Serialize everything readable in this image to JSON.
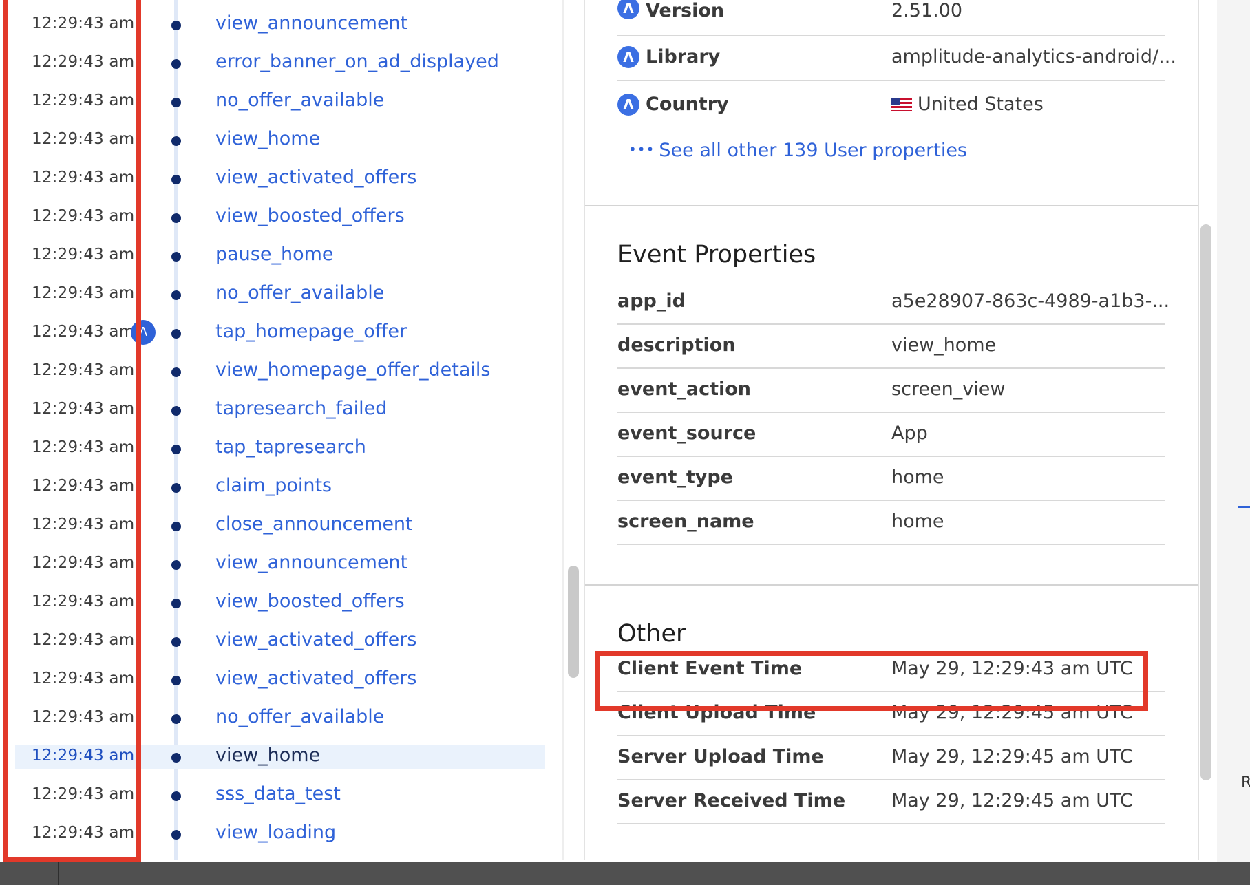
{
  "timeline": {
    "rows": [
      {
        "time": "12:29:43 am",
        "event": "view_announcement"
      },
      {
        "time": "12:29:43 am",
        "event": "error_banner_on_ad_displayed"
      },
      {
        "time": "12:29:43 am",
        "event": "no_offer_available"
      },
      {
        "time": "12:29:43 am",
        "event": "view_home"
      },
      {
        "time": "12:29:43 am",
        "event": "view_activated_offers"
      },
      {
        "time": "12:29:43 am",
        "event": "view_boosted_offers"
      },
      {
        "time": "12:29:43 am",
        "event": "pause_home"
      },
      {
        "time": "12:29:43 am",
        "event": "no_offer_available"
      },
      {
        "time": "12:29:43 am",
        "event": "tap_homepage_offer"
      },
      {
        "time": "12:29:43 am",
        "event": "view_homepage_offer_details"
      },
      {
        "time": "12:29:43 am",
        "event": "tapresearch_failed"
      },
      {
        "time": "12:29:43 am",
        "event": "tap_tapresearch"
      },
      {
        "time": "12:29:43 am",
        "event": "claim_points"
      },
      {
        "time": "12:29:43 am",
        "event": "close_announcement"
      },
      {
        "time": "12:29:43 am",
        "event": "view_announcement"
      },
      {
        "time": "12:29:43 am",
        "event": "view_boosted_offers"
      },
      {
        "time": "12:29:43 am",
        "event": "view_activated_offers"
      },
      {
        "time": "12:29:43 am",
        "event": "view_activated_offers"
      },
      {
        "time": "12:29:43 am",
        "event": "no_offer_available"
      },
      {
        "time": "12:29:43 am",
        "event": "view_home"
      },
      {
        "time": "12:29:43 am",
        "event": "sss_data_test"
      },
      {
        "time": "12:29:43 am",
        "event": "view_loading"
      }
    ],
    "selected_index": 19
  },
  "user_properties": {
    "icon": "amplitude-icon",
    "items": [
      {
        "key": "Version",
        "value": "2.51.00"
      },
      {
        "key": "Library",
        "value": "amplitude-analytics-android/..."
      },
      {
        "key": "Country",
        "value": "United States",
        "flag": "us-flag"
      }
    ],
    "see_all_dots": "•••",
    "see_all_label": "See all other 139 User properties"
  },
  "event_properties": {
    "title": "Event Properties",
    "items": [
      {
        "key": "app_id",
        "value": "a5e28907-863c-4989-a1b3-..."
      },
      {
        "key": "description",
        "value": "view_home"
      },
      {
        "key": "event_action",
        "value": "screen_view"
      },
      {
        "key": "event_source",
        "value": "App"
      },
      {
        "key": "event_type",
        "value": "home"
      },
      {
        "key": "screen_name",
        "value": "home"
      }
    ]
  },
  "other": {
    "title": "Other",
    "items": [
      {
        "key": "Client Event Time",
        "value": "May 29, 12:29:43 am UTC"
      },
      {
        "key": "Client Upload Time",
        "value": "May 29, 12:29:45 am UTC"
      },
      {
        "key": "Server Upload Time",
        "value": "May 29, 12:29:45 am UTC"
      },
      {
        "key": "Server Received Time",
        "value": "May 29, 12:29:45 am UTC"
      }
    ]
  },
  "edge": {
    "letter": "R"
  },
  "colors": {
    "highlight": "#e2392a",
    "link": "#2f62d8",
    "dot": "#102a6b"
  }
}
